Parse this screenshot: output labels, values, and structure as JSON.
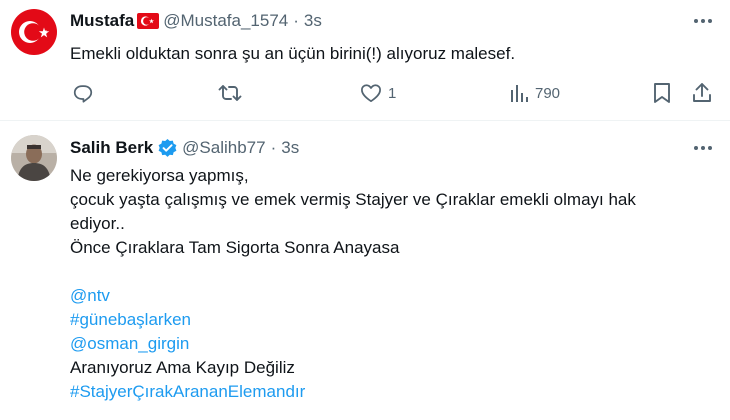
{
  "tweet1": {
    "author_name": "Mustafa",
    "handle": "@Mustafa_1574",
    "separator": "·",
    "time": "3s",
    "text": "Emekli olduktan sonra şu an üçün birini(!) alıyoruz malesef.",
    "likes": "1",
    "views": "790",
    "avatar_icon": "turkish-flag-avatar",
    "name_badge_icon": "turkish-flag-emoji"
  },
  "tweet2": {
    "author_name": "Salih Berk",
    "handle": "@Salihb77",
    "separator": "·",
    "time": "3s",
    "verified_icon": "verified-badge-icon",
    "lines": [
      "Ne gerekiyorsa yapmış,",
      "çocuk yaşta çalışmış ve emek vermiş Stajyer ve Çıraklar emekli olmayı hak",
      "ediyor..",
      "Önce Çıraklara Tam Sigorta Sonra Anayasa"
    ],
    "mention_ntv": "@ntv",
    "hashtag_gunebaslarken": "#günebaşlarken",
    "mention_osman": "@osman_girgin",
    "closing_line": "Aranıyoruz Ama Kayıp Değiliz",
    "hashtag_stajyer": "#StajyerÇırakArananElemandır"
  },
  "colors": {
    "text": "#0f1419",
    "secondary": "#536471",
    "link": "#1d9bf0",
    "flag_red": "#e30a17",
    "divider": "#eff3f4"
  }
}
